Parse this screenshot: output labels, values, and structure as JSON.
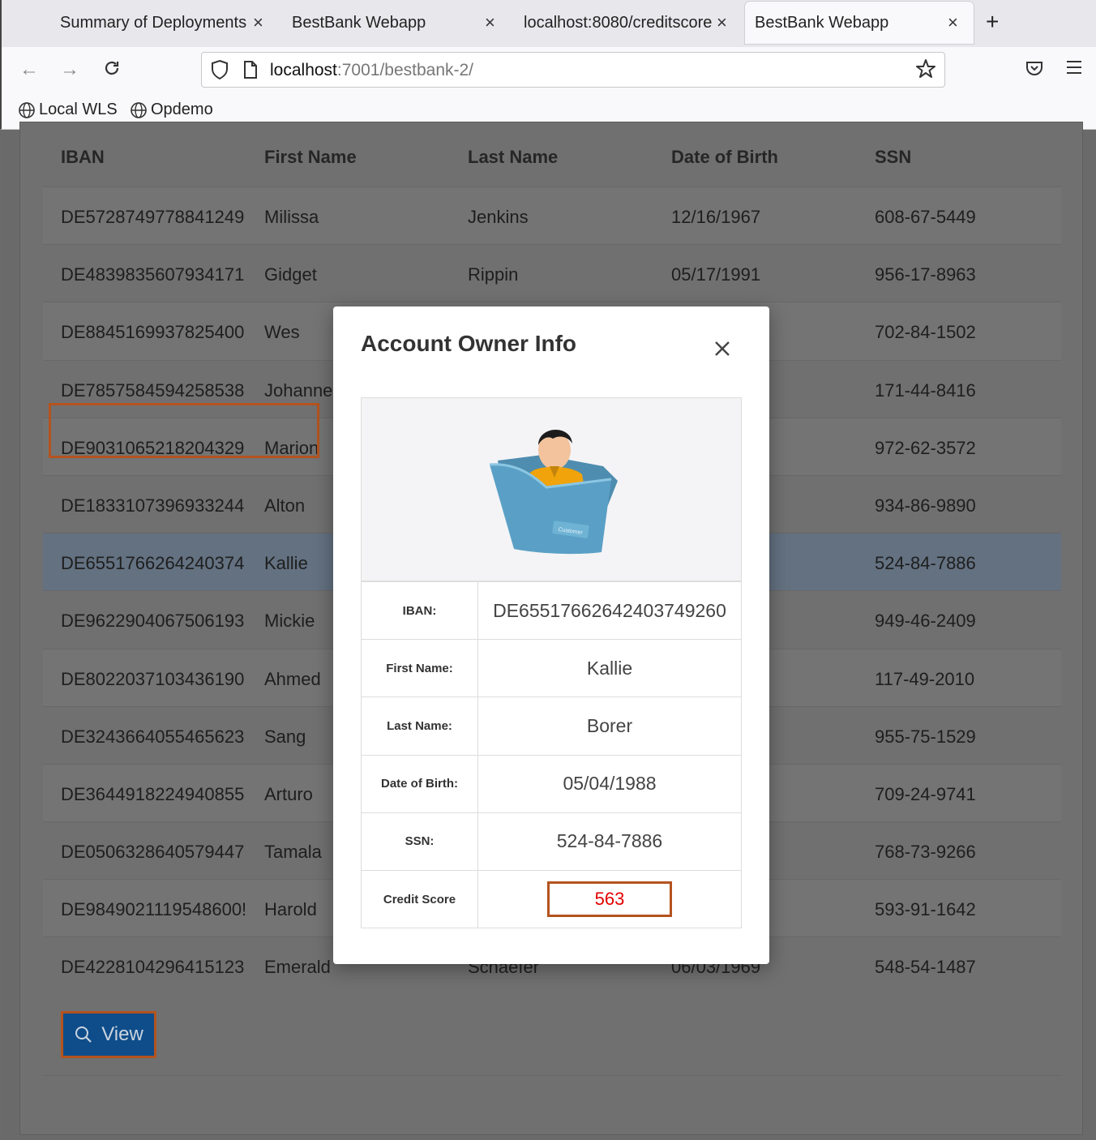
{
  "browser": {
    "tabs": [
      {
        "title": "Summary of Deployments",
        "active": false
      },
      {
        "title": "BestBank Webapp",
        "active": false
      },
      {
        "title": "localhost:8080/creditscore",
        "active": false
      },
      {
        "title": "BestBank Webapp",
        "active": true
      }
    ],
    "url_host": "localhost",
    "url_rest": ":7001/bestbank-2/",
    "bookmarks": [
      "Local WLS",
      "Opdemo"
    ]
  },
  "table": {
    "headers": [
      "IBAN",
      "First Name",
      "Last Name",
      "Date of Birth",
      "SSN"
    ],
    "rows": [
      {
        "iban": "DE5728749778841249",
        "first": "Milissa",
        "last": "Jenkins",
        "dob": "12/16/1967",
        "ssn": "608-67-5449"
      },
      {
        "iban": "DE4839835607934171",
        "first": "Gidget",
        "last": "Rippin",
        "dob": "05/17/1991",
        "ssn": "956-17-8963"
      },
      {
        "iban": "DE8845169937825400",
        "first": "Wes",
        "last": "",
        "dob": "",
        "ssn": "702-84-1502"
      },
      {
        "iban": "DE7857584594258538",
        "first": "Johanne",
        "last": "",
        "dob": "",
        "ssn": "171-44-8416"
      },
      {
        "iban": "DE9031065218204329",
        "first": "Marion",
        "last": "",
        "dob": "",
        "ssn": "972-62-3572"
      },
      {
        "iban": "DE1833107396933244",
        "first": "Alton",
        "last": "",
        "dob": "",
        "ssn": "934-86-9890"
      },
      {
        "iban": "DE6551766264240374",
        "first": "Kallie",
        "last": "",
        "dob": "",
        "ssn": "524-84-7886"
      },
      {
        "iban": "DE9622904067506193",
        "first": "Mickie",
        "last": "",
        "dob": "",
        "ssn": "949-46-2409"
      },
      {
        "iban": "DE8022037103436190",
        "first": "Ahmed",
        "last": "",
        "dob": "",
        "ssn": "117-49-2010"
      },
      {
        "iban": "DE3243664055465623",
        "first": "Sang",
        "last": "",
        "dob": "",
        "ssn": "955-75-1529"
      },
      {
        "iban": "DE3644918224940855",
        "first": "Arturo",
        "last": "",
        "dob": "",
        "ssn": "709-24-9741"
      },
      {
        "iban": "DE0506328640579447",
        "first": "Tamala",
        "last": "",
        "dob": "",
        "ssn": "768-73-9266"
      },
      {
        "iban": "DE9849021119548600!",
        "first": "Harold",
        "last": "",
        "dob": "",
        "ssn": "593-91-1642"
      },
      {
        "iban": "DE4228104296415123",
        "first": "Emerald",
        "last": "Schaefer",
        "dob": "06/03/1969",
        "ssn": "548-54-1487"
      }
    ],
    "selected_index": 6
  },
  "view_button": {
    "label": "View"
  },
  "modal": {
    "title": "Account Owner Info",
    "avatar_caption": "Customer",
    "fields": [
      {
        "label": "IBAN:",
        "value": "DE65517662642403749260"
      },
      {
        "label": "First Name:",
        "value": "Kallie"
      },
      {
        "label": "Last Name:",
        "value": "Borer"
      },
      {
        "label": "Date of Birth:",
        "value": "05/04/1988"
      },
      {
        "label": "SSN:",
        "value": "524-84-7886"
      }
    ],
    "credit_score": {
      "label": "Credit Score",
      "value": "563"
    }
  },
  "colors": {
    "accent_highlight": "#b4531f",
    "score_red": "#e30000",
    "view_button": "#0f4d8a"
  }
}
